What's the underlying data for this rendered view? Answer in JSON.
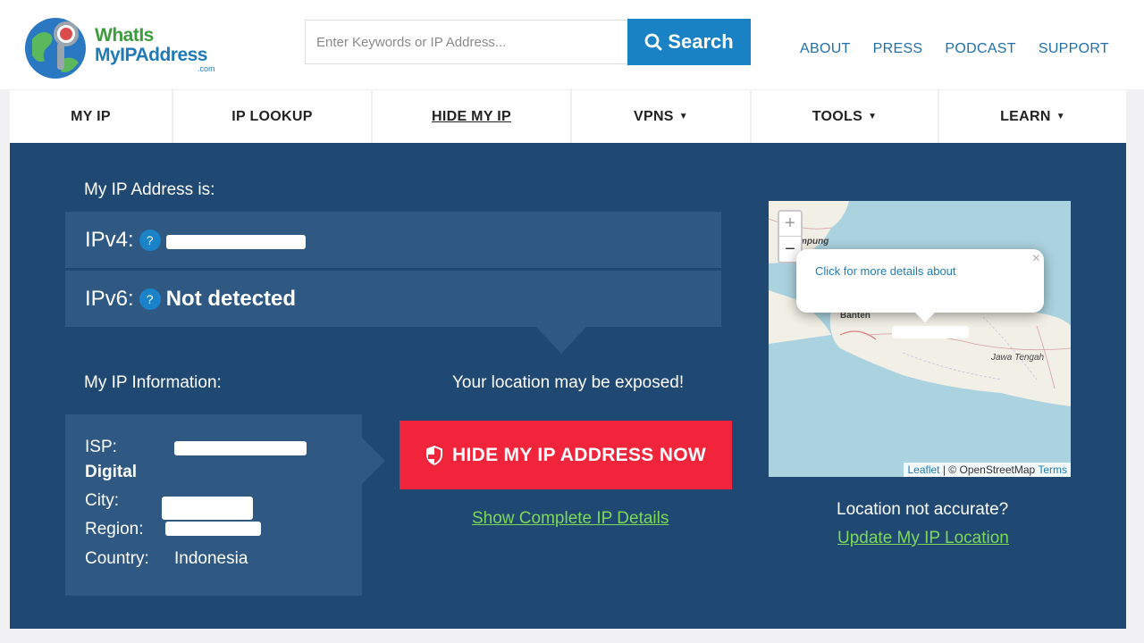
{
  "logo": {
    "line1": "WhatIs",
    "line2": "MyIPAddress",
    "suffix": ".com"
  },
  "search": {
    "placeholder": "Enter Keywords or IP Address...",
    "button_label": "Search"
  },
  "top_links": [
    "ABOUT",
    "PRESS",
    "PODCAST",
    "SUPPORT"
  ],
  "nav": [
    {
      "label": "MY IP"
    },
    {
      "label": "IP LOOKUP"
    },
    {
      "label": "HIDE MY IP"
    },
    {
      "label": "VPNS"
    },
    {
      "label": "TOOLS"
    },
    {
      "label": "LEARN"
    }
  ],
  "ip": {
    "heading": "My IP Address is:",
    "ipv4_label": "IPv4:",
    "ipv6_label": "IPv6:",
    "ipv6_value": "Not detected",
    "help_glyph": "?"
  },
  "info": {
    "heading": "My IP Information:",
    "isp_label": "ISP:",
    "isp_continuation": "Digital",
    "city_label": "City:",
    "region_label": "Region:",
    "country_label": "Country:",
    "country_value": "Indonesia"
  },
  "cta": {
    "warning": "Your location may be exposed!",
    "button_label": "HIDE MY IP ADDRESS NOW",
    "details_link": "Show Complete IP Details"
  },
  "map": {
    "zoom_in": "+",
    "zoom_out": "−",
    "popup_text": "Click for more details about",
    "popup_close": "×",
    "labels": [
      "mpung",
      "Banten",
      "Jawa Tengah"
    ],
    "attrib_leaflet": "Leaflet",
    "attrib_osm": "| © OpenStreetMap",
    "attrib_terms": "Terms"
  },
  "location": {
    "question": "Location not accurate?",
    "update_link": "Update My IP Location"
  },
  "colors": {
    "panel": "#1f4873",
    "panel_light": "#2f5983",
    "accent_blue": "#1882c4",
    "cta_red": "#f0243a",
    "link_green": "#7ed957"
  }
}
